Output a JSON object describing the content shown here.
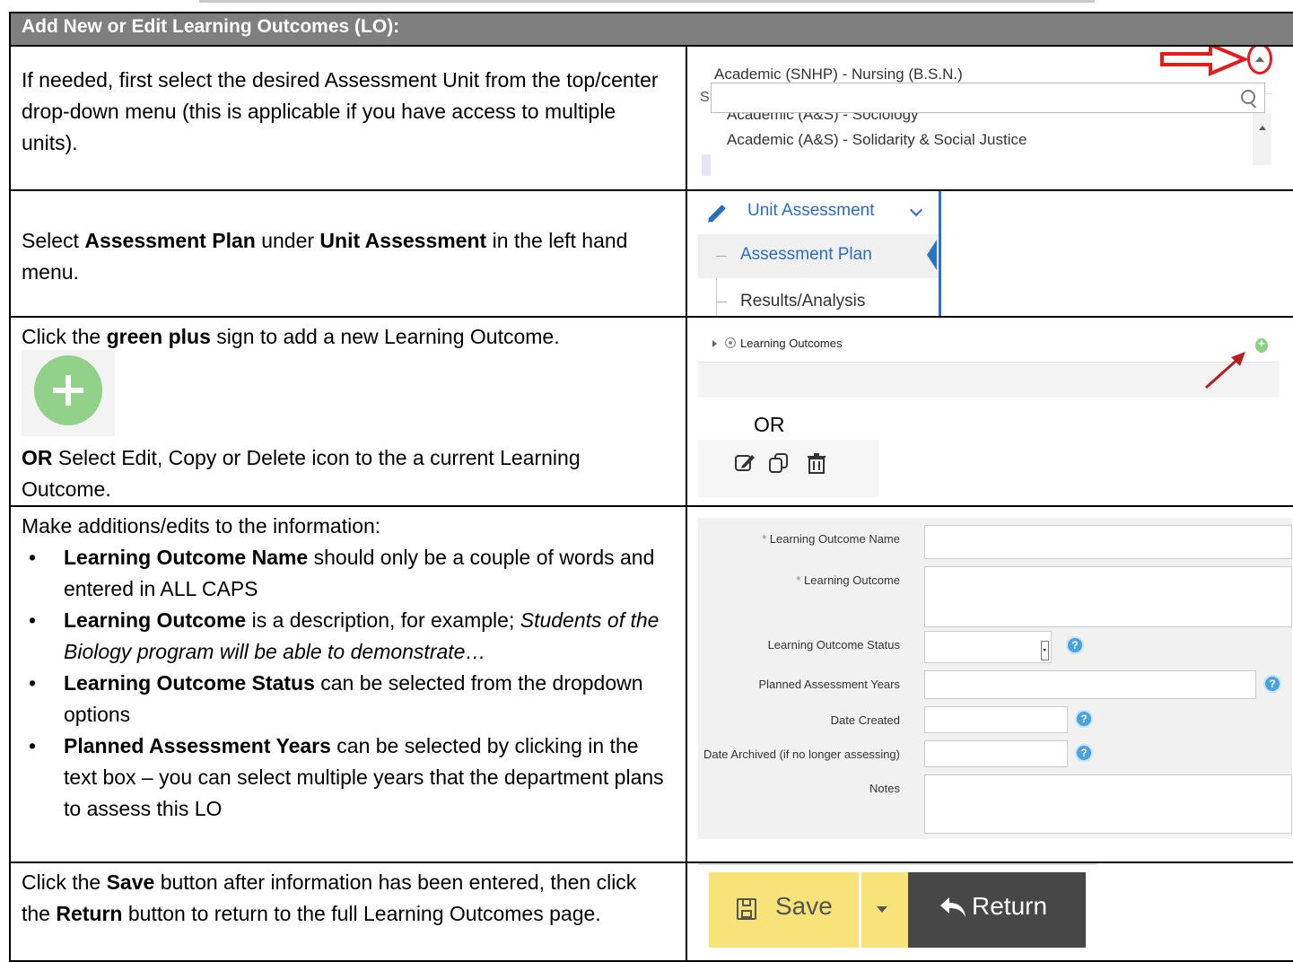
{
  "header": "Add New or Edit Learning Outcomes (LO):",
  "row1": {
    "text_a": "If needed, first select the desired Assessment Unit from the top/center drop-down menu (this is applicable if you have access to multiple units).",
    "dropdown_selected": "Academic (SNHP) - Nursing (B.S.N.)",
    "dropdown_items": [
      "Academic (A&S) - Sociology",
      "Academic (A&S) - Solidarity & Social Justice"
    ],
    "cut_letter": "S"
  },
  "row2": {
    "t1": "Select ",
    "b1": "Assessment Plan",
    "t2": " under ",
    "b2": "Unit Assessment",
    "t3": " in the left hand menu.",
    "menu_title": "Unit Assessment",
    "menu_items": [
      "Assessment Plan",
      "Results/Analysis"
    ]
  },
  "row3": {
    "t1": "Click the ",
    "b1": "green plus",
    "t2": " sign to add a new Learning Outcome.",
    "b2": "OR",
    "t3": " Select Edit, Copy or Delete icon to the a current Learning Outcome.",
    "lo_label": "Learning Outcomes",
    "or_label": "OR"
  },
  "row4": {
    "intro": "Make additions/edits to the information:",
    "bullets": [
      {
        "b": "Learning Outcome Name",
        "t": " should only be a couple of words and entered in ALL CAPS",
        "i": ""
      },
      {
        "b": "Learning Outcome",
        "t": " is a description, for example; ",
        "i": "Students of the Biology program will be able to demonstrate…"
      },
      {
        "b": "Learning Outcome Status",
        "t": " can be selected from the dropdown options",
        "i": ""
      },
      {
        "b": "Planned Assessment Years",
        "t": " can be selected by clicking in the text box – you can select multiple years that the department plans to assess this LO",
        "i": ""
      }
    ],
    "form": {
      "name": "Learning Outcome Name",
      "outcome": "Learning Outcome",
      "status": "Learning Outcome Status",
      "years": "Planned Assessment Years",
      "created": "Date Created",
      "archived": "Date Archived (if no longer assessing)",
      "notes": "Notes",
      "asterisk": "*",
      "help": "?"
    }
  },
  "row5": {
    "t1": "Click the ",
    "b1": "Save",
    "t2": " button after information has been entered, then click the ",
    "b2": "Return",
    "t3": " button to return to the full Learning Outcomes page.",
    "save_label": "Save",
    "return_label": "Return"
  },
  "colors": {
    "header_bg": "#7f7f7f",
    "green_plus": "#92d18a",
    "save_yellow": "#f8e27a",
    "return_dark": "#474747",
    "link_blue": "#2a6cc0",
    "red": "#e31b1b"
  }
}
